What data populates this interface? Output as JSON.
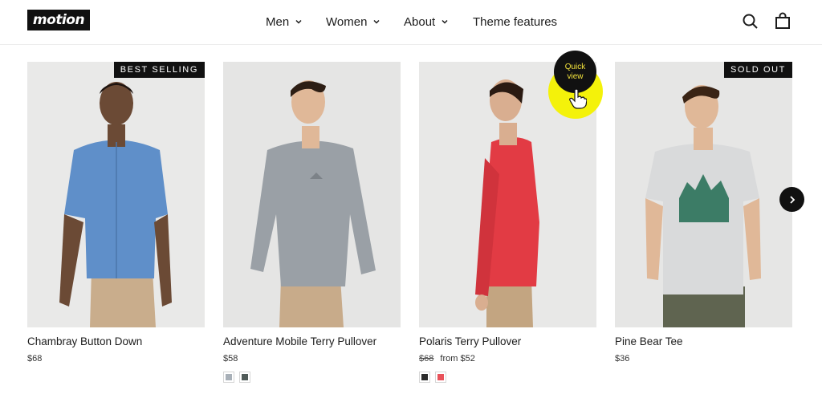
{
  "header": {
    "logo": "motion",
    "nav": [
      {
        "label": "Men"
      },
      {
        "label": "Women"
      },
      {
        "label": "About"
      },
      {
        "label": "Theme features"
      }
    ],
    "icons": [
      "search-icon",
      "cart-icon"
    ]
  },
  "products": [
    {
      "badge": "BEST SELLING",
      "title": "Chambray Button Down",
      "price": "$68",
      "shirt_color": "#5f8fc9"
    },
    {
      "title": "Adventure Mobile Terry Pullover",
      "price": "$58",
      "shirt_color": "#9aa0a6",
      "swatches": [
        "#a8b0b8",
        "#4f5a58"
      ]
    },
    {
      "title": "Polaris Terry Pullover",
      "price_old": "$68",
      "price_from": "from $52",
      "shirt_color": "#e23b44",
      "swatches": [
        "#2a2a2a",
        "#e8525a"
      ],
      "quick_view_line1": "Quick",
      "quick_view_line2": "view"
    },
    {
      "badge": "SOLD OUT",
      "title": "Pine Bear Tee",
      "price": "$36",
      "shirt_color": "#d9dadb"
    }
  ],
  "carousel": {
    "next_icon": "chevron-right-icon"
  },
  "colors": {
    "brand": "#111111",
    "highlight": "#f4f20a",
    "quick_view_text": "#f4e43c"
  }
}
